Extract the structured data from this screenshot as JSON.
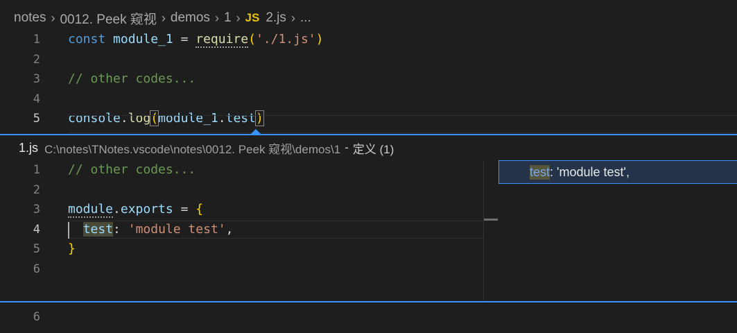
{
  "breadcrumb": {
    "items": [
      "notes",
      "0012. Peek 窥视",
      "demos",
      "1"
    ],
    "file_badge": "JS",
    "file_name": "2.js",
    "overflow": "..."
  },
  "editor": {
    "lines": [
      {
        "num": "1",
        "parts": [
          {
            "text": "const ",
            "cls": "kw"
          },
          {
            "text": "module_1",
            "cls": "var"
          },
          {
            "text": " = ",
            "cls": ""
          },
          {
            "text": "require",
            "cls": "fn dots"
          },
          {
            "text": "(",
            "cls": "br"
          },
          {
            "text": "'./1.js'",
            "cls": "str"
          },
          {
            "text": ")",
            "cls": "br"
          }
        ]
      },
      {
        "num": "2",
        "parts": []
      },
      {
        "num": "3",
        "parts": [
          {
            "text": "// other codes...",
            "cls": "cm"
          }
        ]
      },
      {
        "num": "4",
        "parts": []
      },
      {
        "num": "5",
        "parts": [
          {
            "text": "console",
            "cls": "var"
          },
          {
            "text": ".",
            "cls": ""
          },
          {
            "text": "log",
            "cls": "fn"
          },
          {
            "text": "(",
            "cls": "br bracket-match"
          },
          {
            "text": "module_1",
            "cls": "var"
          },
          {
            "text": ".",
            "cls": ""
          },
          {
            "text": "test",
            "cls": "var"
          },
          {
            "text": ")",
            "cls": "br bracket-match"
          }
        ]
      }
    ],
    "trailing_line": "6"
  },
  "peek": {
    "file": "1.js",
    "path": "C:\\notes\\TNotes.vscode\\notes\\0012. Peek 窥视\\demos\\1",
    "separator": "-",
    "definition_label": "定义 (1)",
    "lines": [
      {
        "num": "1",
        "parts": [
          {
            "text": "// other codes...",
            "cls": "cm"
          }
        ]
      },
      {
        "num": "2",
        "parts": []
      },
      {
        "num": "3",
        "parts": [
          {
            "text": "module",
            "cls": "var dots"
          },
          {
            "text": ".",
            "cls": ""
          },
          {
            "text": "exports",
            "cls": "var"
          },
          {
            "text": " = ",
            "cls": ""
          },
          {
            "text": "{",
            "cls": "br"
          }
        ]
      },
      {
        "num": "4",
        "parts": [
          {
            "text": "  ",
            "cls": ""
          },
          {
            "text": "test",
            "cls": "prop word-hl"
          },
          {
            "text": ": ",
            "cls": ""
          },
          {
            "text": "'module test'",
            "cls": "str"
          },
          {
            "text": ",",
            "cls": ""
          }
        ]
      },
      {
        "num": "5",
        "parts": [
          {
            "text": "}",
            "cls": "br"
          }
        ]
      },
      {
        "num": "6",
        "parts": []
      }
    ],
    "reference": {
      "match": "test",
      "rest": ": 'module test',"
    }
  }
}
